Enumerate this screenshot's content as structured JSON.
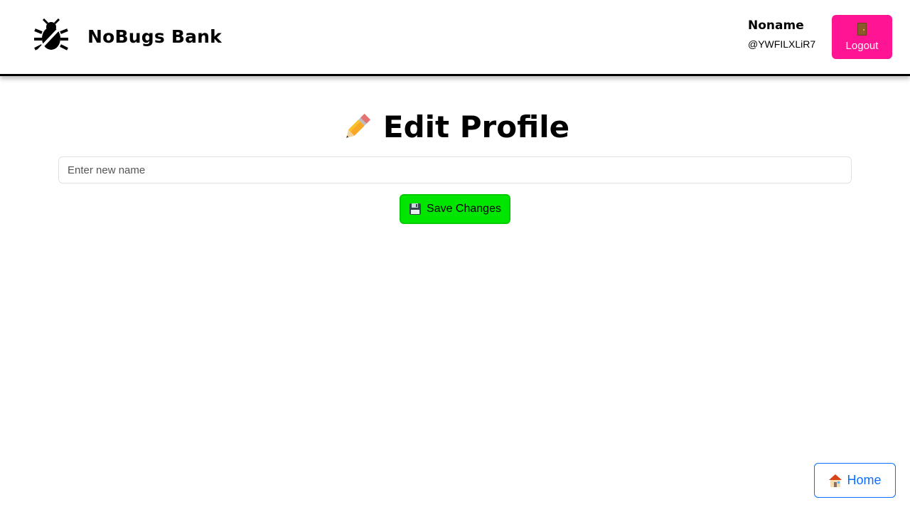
{
  "header": {
    "brand_name": "NoBugs Bank",
    "logo_icon": "bug-crossed-icon",
    "user": {
      "name": "Noname",
      "handle": "@YWFILXLiR7"
    },
    "logout_label": "Logout",
    "logout_icon": "door-icon",
    "logout_color": "#ff1493"
  },
  "main": {
    "title": "Edit Profile",
    "title_icon": "pencil-icon",
    "name_input": {
      "placeholder": "Enter new name",
      "value": ""
    },
    "save_label": "Save Changes",
    "save_icon": "floppy-disk-icon",
    "save_color": "#00e600"
  },
  "footer": {
    "home_label": "Home",
    "home_icon": "house-icon",
    "home_color": "#0d6efd"
  }
}
